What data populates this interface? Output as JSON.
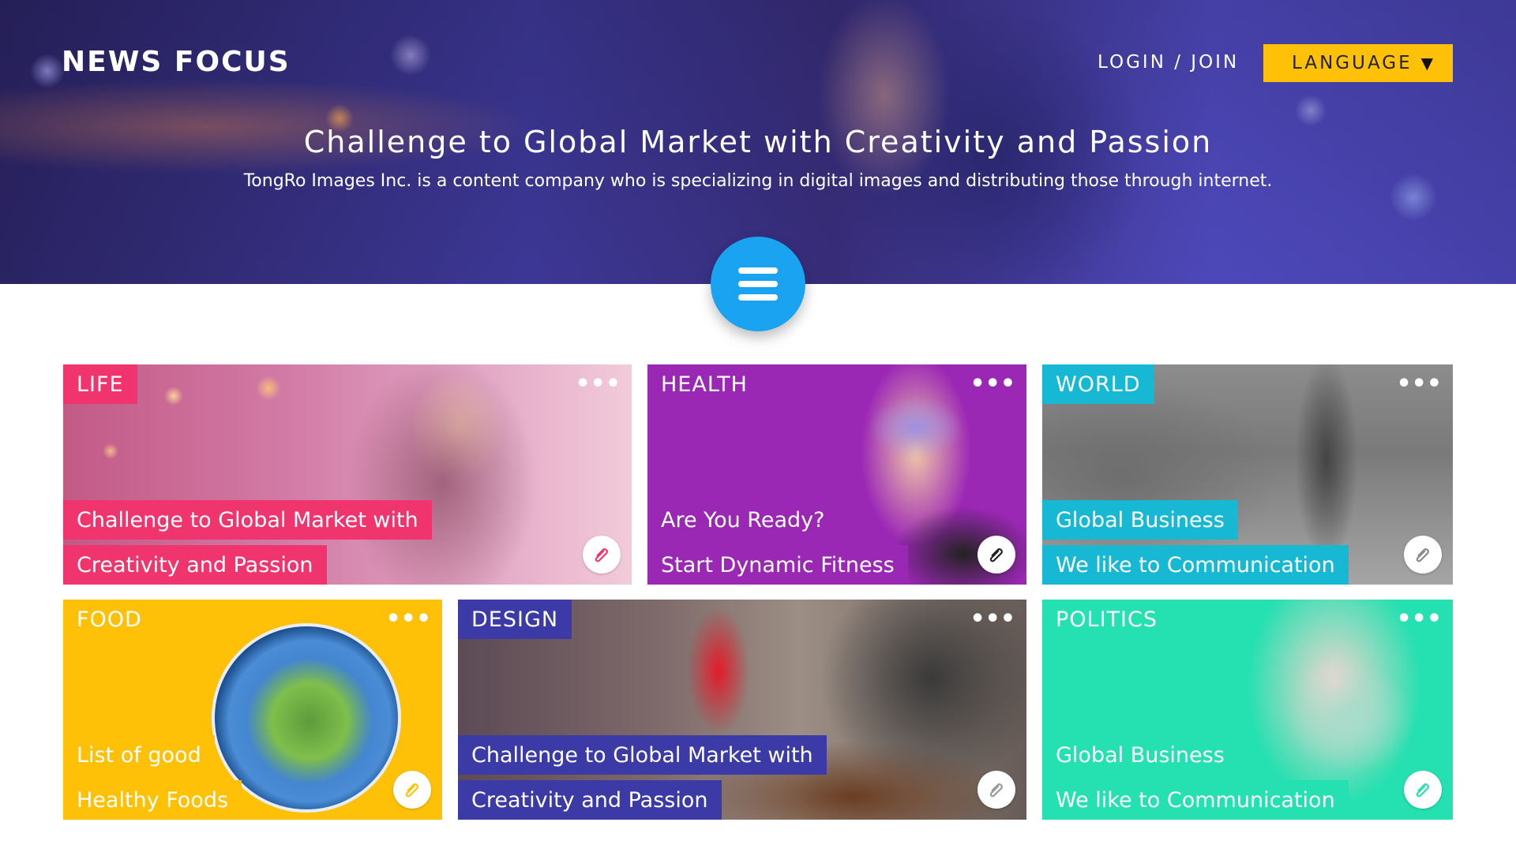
{
  "header": {
    "brand": "NEWS FOCUS",
    "login_label": "LOGIN / JOIN",
    "language_label": "LANGUAGE",
    "language_caret": "▼"
  },
  "hero": {
    "title": "Challenge to Global Market with Creativity and Passion",
    "subtitle": "TongRo Images Inc. is a content company who is specializing in digital images and distributing those through internet."
  },
  "menu_button": {
    "icon": "hamburger-menu-icon",
    "color": "#1aa3f0"
  },
  "cards": {
    "life": {
      "tag": "LIFE",
      "line1": "Challenge to Global Market with",
      "line2": "Creativity and Passion",
      "color": "#f0356e"
    },
    "health": {
      "tag": "HEALTH",
      "line1": "Are You Ready?",
      "line2": "Start Dynamic Fitness",
      "color": "#9b27b5"
    },
    "world": {
      "tag": "WORLD",
      "line1": "Global Business",
      "line2": "We like to Communication",
      "color": "#17b8d4"
    },
    "food": {
      "tag": "FOOD",
      "line1": "List of good",
      "line2": "Healthy Foods",
      "color": "#ffc107"
    },
    "design": {
      "tag": "DESIGN",
      "line1": "Challenge to Global Market with",
      "line2": "Creativity and Passion",
      "color": "#3b3aa6"
    },
    "politics": {
      "tag": "POLITICS",
      "line1": "Global Business",
      "line2": "We like to Communication",
      "color": "#25e0b0"
    }
  },
  "icons": {
    "more": "more-dots-icon",
    "attachment": "paperclip-icon",
    "caret": "caret-down-icon"
  },
  "more_label": "•••"
}
